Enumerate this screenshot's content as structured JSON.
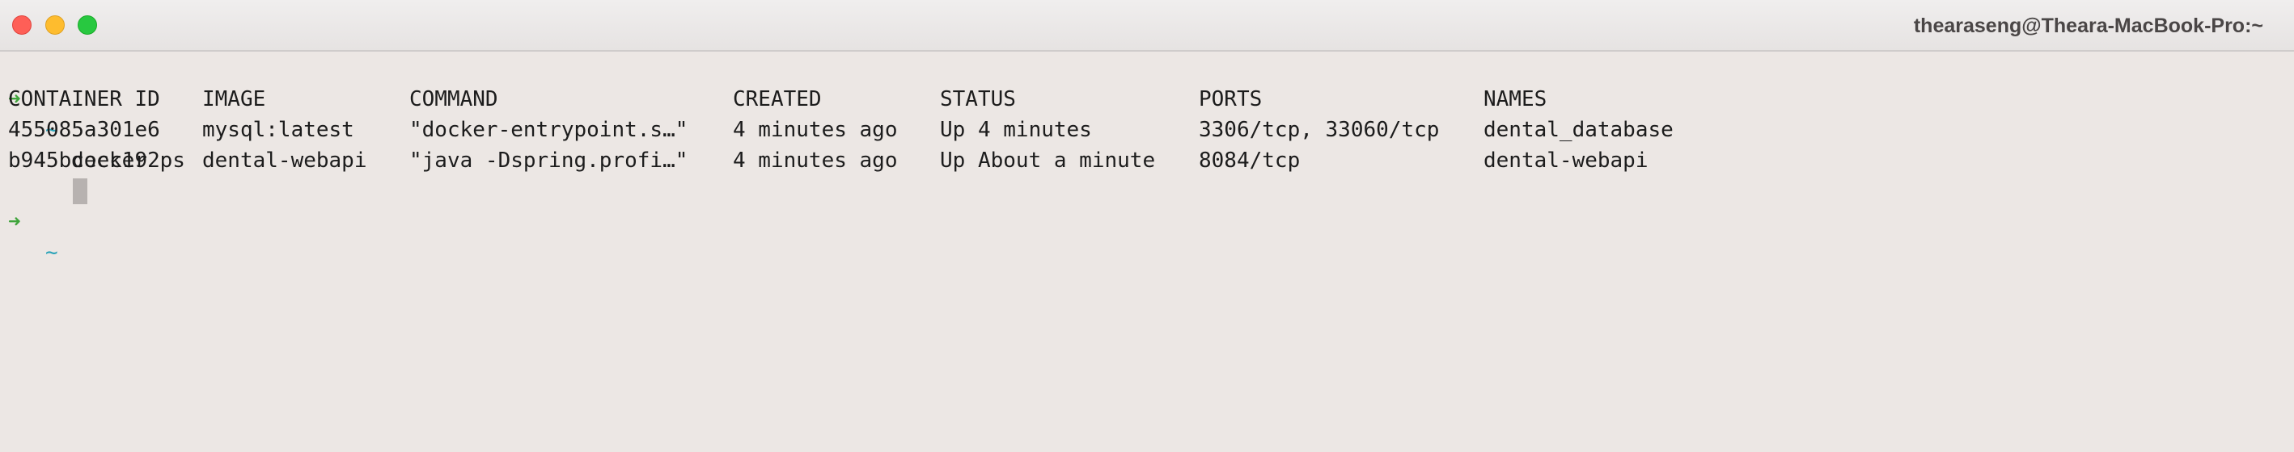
{
  "window": {
    "title": "thearaseng@Theara-MacBook-Pro:~"
  },
  "terminal": {
    "prompt_symbol": "➜",
    "prompt_dir": "~",
    "command": "docker ps",
    "table": {
      "headers": [
        "CONTAINER ID",
        "IMAGE",
        "COMMAND",
        "CREATED",
        "STATUS",
        "PORTS",
        "NAMES"
      ],
      "rows": [
        [
          "455085a301e6",
          "mysql:latest",
          "\"docker-entrypoint.s…\"",
          "4 minutes ago",
          "Up 4 minutes",
          "3306/tcp, 33060/tcp",
          "dental_database"
        ],
        [
          "b945bceec192",
          "dental-webapi",
          "\"java -Dspring.profi…\"",
          "4 minutes ago",
          "Up About a minute",
          "8084/tcp",
          "dental-webapi"
        ]
      ]
    }
  },
  "colors": {
    "prompt_arrow": "#3fa43b",
    "prompt_dir": "#2aa3b8",
    "background": "#ece7e4"
  }
}
